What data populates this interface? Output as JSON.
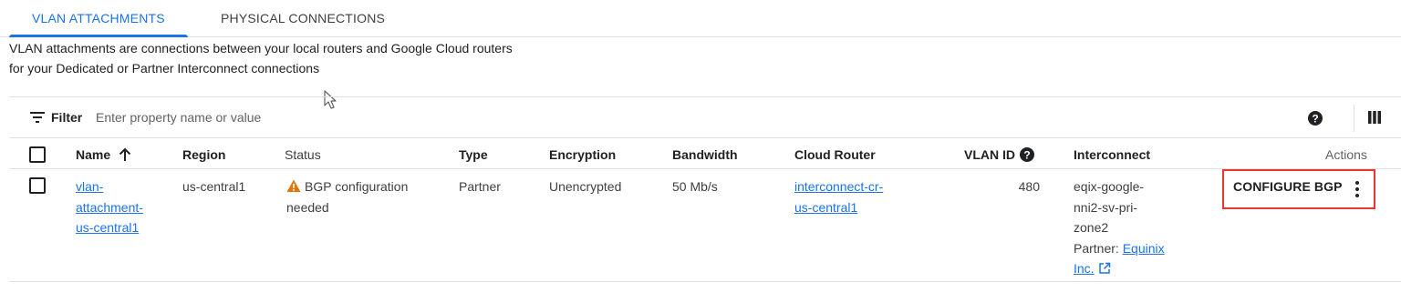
{
  "tabs": [
    {
      "label": "VLAN ATTACHMENTS",
      "active": true
    },
    {
      "label": "PHYSICAL CONNECTIONS",
      "active": false
    }
  ],
  "description": {
    "line1": "VLAN attachments are connections between your local routers and Google Cloud routers",
    "line2": "for your Dedicated or Partner Interconnect connections"
  },
  "filter": {
    "label": "Filter",
    "placeholder": "Enter property name or value",
    "filter_icon": "filter-list-icon",
    "help_icon": "help-circle-icon",
    "columns_icon": "column-display-icon"
  },
  "table": {
    "headers": {
      "name": "Name",
      "name_sort_icon": "arrow-up-icon",
      "region": "Region",
      "status": "Status",
      "type": "Type",
      "encryption": "Encryption",
      "bandwidth": "Bandwidth",
      "cloud_router": "Cloud Router",
      "vlan_id": "VLAN ID",
      "interconnect": "Interconnect",
      "actions": "Actions"
    },
    "rows": [
      {
        "name_lines": [
          "vlan-",
          "attachment-",
          "us-central1"
        ],
        "region": "us-central1",
        "status_lines": [
          "BGP configuration",
          "needed"
        ],
        "status_icon": "warning-icon",
        "type": "Partner",
        "encryption": "Unencrypted",
        "bandwidth": "50 Mb/s",
        "cloud_router_lines": [
          "interconnect-cr-",
          "us-central1"
        ],
        "vlan_id": "480",
        "interconnect_lines": [
          "eqix-google-",
          "nni2-sv-pri-",
          "zone2"
        ],
        "partner_prefix": "Partner: ",
        "partner_link_lines": [
          "Equinix",
          "Inc."
        ],
        "action_label": "CONFIGURE BGP"
      }
    ]
  },
  "colors": {
    "accent": "#1a73e8",
    "warning": "#e37400",
    "highlight_border": "#e53935"
  }
}
